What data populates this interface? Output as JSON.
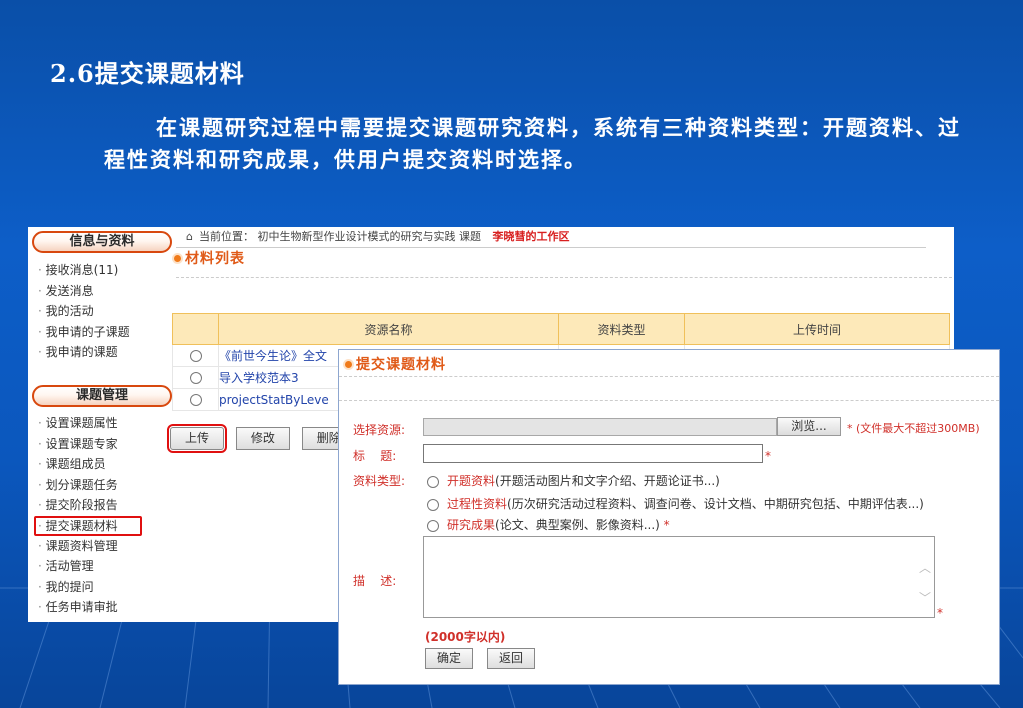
{
  "slide": {
    "title": "2.6提交课题材料",
    "paragraph": "在课题研究过程中需要提交课题研究资料，系统有三种资料类型：开题资料、过程性资料和研究成果，供用户提交资料时选择。"
  },
  "sidebar": {
    "section1": {
      "header": "信息与资料",
      "items": [
        "接收消息(11)",
        "发送消息",
        "我的活动",
        "我申请的子课题",
        "我申请的课题"
      ]
    },
    "section2": {
      "header": "课题管理",
      "items": [
        "设置课题属性",
        "设置课题专家",
        "课题组成员",
        "划分课题任务",
        "提交阶段报告",
        "提交课题材料",
        "课题资料管理",
        "活动管理",
        "我的提问",
        "任务申请审批"
      ]
    }
  },
  "breadcrumb": {
    "prefix": "当前位置：",
    "path": "初中生物新型作业设计模式的研究与实践 课题",
    "workspace": "李晓彗的工作区"
  },
  "material_list": {
    "title": "材料列表",
    "columns": [
      "资源名称",
      "资料类型",
      "上传时间"
    ],
    "rows": [
      {
        "name": "《前世今生论》全文"
      },
      {
        "name": "导入学校范本3"
      },
      {
        "name": "projectStatByLeve"
      }
    ],
    "buttons": {
      "upload": "上传",
      "edit": "修改",
      "delete": "删除"
    }
  },
  "popup": {
    "title": "提交课题材料",
    "resource_label": "选择资源:",
    "browse_label": "浏览...",
    "file_note": "* (文件最大不超过300MB)",
    "title_label": "标    题:",
    "title_value": "",
    "type_label": "资料类型:",
    "types": [
      {
        "name": "开题资料",
        "desc": "(开题活动图片和文字介绍、开题论证书...)"
      },
      {
        "name": "过程性资料",
        "desc": "(历次研究活动过程资料、调查问卷、设计文档、中期研究包括、中期评估表...)"
      },
      {
        "name": "研究成果",
        "desc": "(论文、典型案例、影像资料...)"
      }
    ],
    "required_mark": "*",
    "desc_label": "描    述:",
    "desc_value": "",
    "limit_note": "(2000字以内)",
    "ok": "确定",
    "back": "返回"
  }
}
